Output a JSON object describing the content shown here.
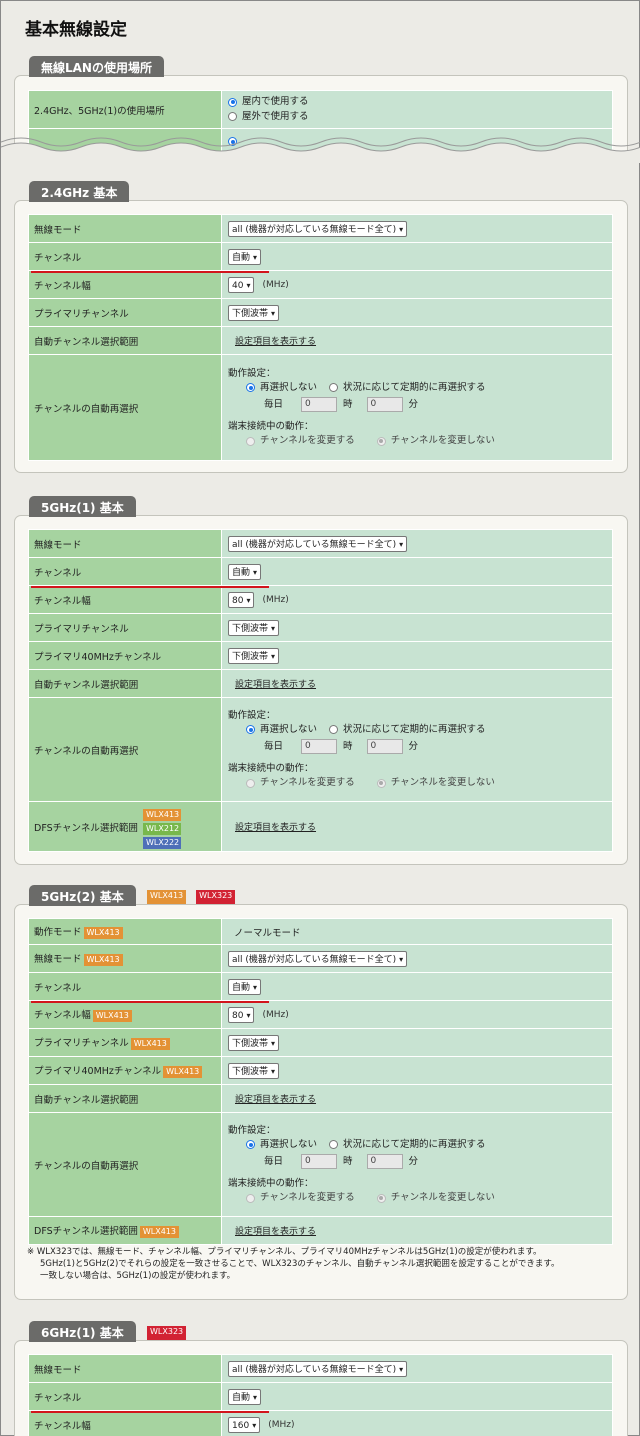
{
  "page_title": "基本無線設定",
  "s0": {
    "tab": "無線LANの使用場所",
    "label": "2.4GHz、5GHz(1)の使用場所",
    "opt_indoor": "屋内で使用する",
    "opt_outdoor": "屋外で使用する"
  },
  "common": {
    "mode_label": "無線モード",
    "mode_value": "all (機器が対応している無線モード全て)",
    "channel_label": "チャンネル",
    "channel_value": "自動",
    "width_label": "チャンネル幅",
    "unit": "(MHz)",
    "primary_label": "プライマリチャンネル",
    "primary_value": "下側波帯",
    "primary40_label": "プライマリ40MHzチャンネル",
    "range_label": "自動チャンネル選択範囲",
    "show_link": "設定項目を表示する",
    "reselect_label": "チャンネルの自動再選択",
    "op_setting": "動作設定：",
    "no_reselect": "再選択しない",
    "periodic": "状況に応じて定期的に再選択する",
    "daily": "毎日",
    "hour_value": "0",
    "hour": "時",
    "minute_value": "0",
    "minute": "分",
    "client_op": "端末接続中の動作：",
    "change": "チャンネルを変更する",
    "nochange": "チャンネルを変更しない",
    "dfs_label": "DFSチャンネル選択範囲",
    "opmode_label": "動作モード",
    "opmode_value": "ノーマルモード"
  },
  "s1": {
    "tab": "2.4GHz 基本",
    "width_value": "40"
  },
  "s2": {
    "tab": "5GHz(1) 基本",
    "width_value": "80"
  },
  "s3": {
    "tab": "5GHz(2) 基本",
    "width_value": "80"
  },
  "s4": {
    "tab": "6GHz(1) 基本",
    "width_value": "160"
  },
  "badges": {
    "wlx413": "WLX413",
    "wlx212": "WLX212",
    "wlx222": "WLX222",
    "wlx323": "WLX323"
  },
  "note": {
    "line1": "※ WLX323では、無線モード、チャンネル幅、プライマリチャンネル、プライマリ40MHzチャンネルは5GHz(1)の設定が使われます。",
    "line2": "5GHz(1)と5GHz(2)でそれらの設定を一致させることで、WLX323のチャンネル、自動チャンネル選択範囲を設定することができます。",
    "line3": "一致しない場合は、5GHz(1)の設定が使われます。"
  },
  "colors": {
    "label_bg": "#a6d3a0",
    "value_bg": "#c8e3d2",
    "tab_bg": "#6b6b69",
    "highlight": "#d2151c",
    "radio_on": "#1a73e8"
  }
}
